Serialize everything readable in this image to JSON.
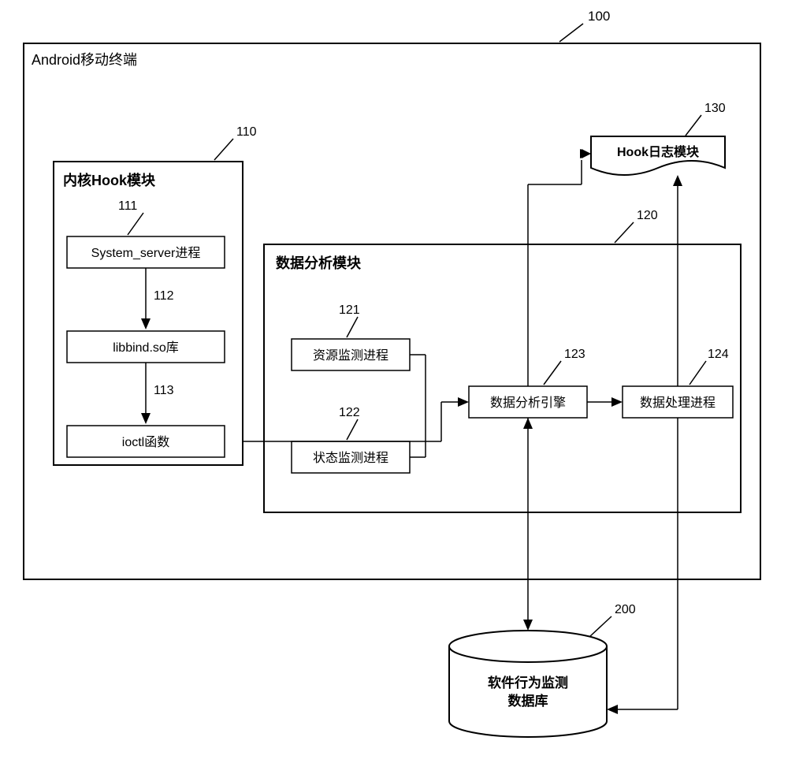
{
  "labels": {
    "outer_title": "Android移动终端",
    "outer_num": "100",
    "kernel_title": "内核Hook模块",
    "kernel_num": "110",
    "b111_text": "System_server进程",
    "b111_num": "111",
    "b112_text": "libbind.so库",
    "b112_num": "112",
    "b113_text": "ioctl函数",
    "b113_num": "113",
    "data_title": "数据分析模块",
    "data_num": "120",
    "b121_text": "资源监测进程",
    "b121_num": "121",
    "b122_text": "状态监测进程",
    "b122_num": "122",
    "b123_text": "数据分析引擎",
    "b123_num": "123",
    "b124_text": "数据处理进程",
    "b124_num": "124",
    "log_text": "Hook日志模块",
    "log_num": "130",
    "db_text_l1": "软件行为监测",
    "db_text_l2": "数据库",
    "db_num": "200"
  }
}
